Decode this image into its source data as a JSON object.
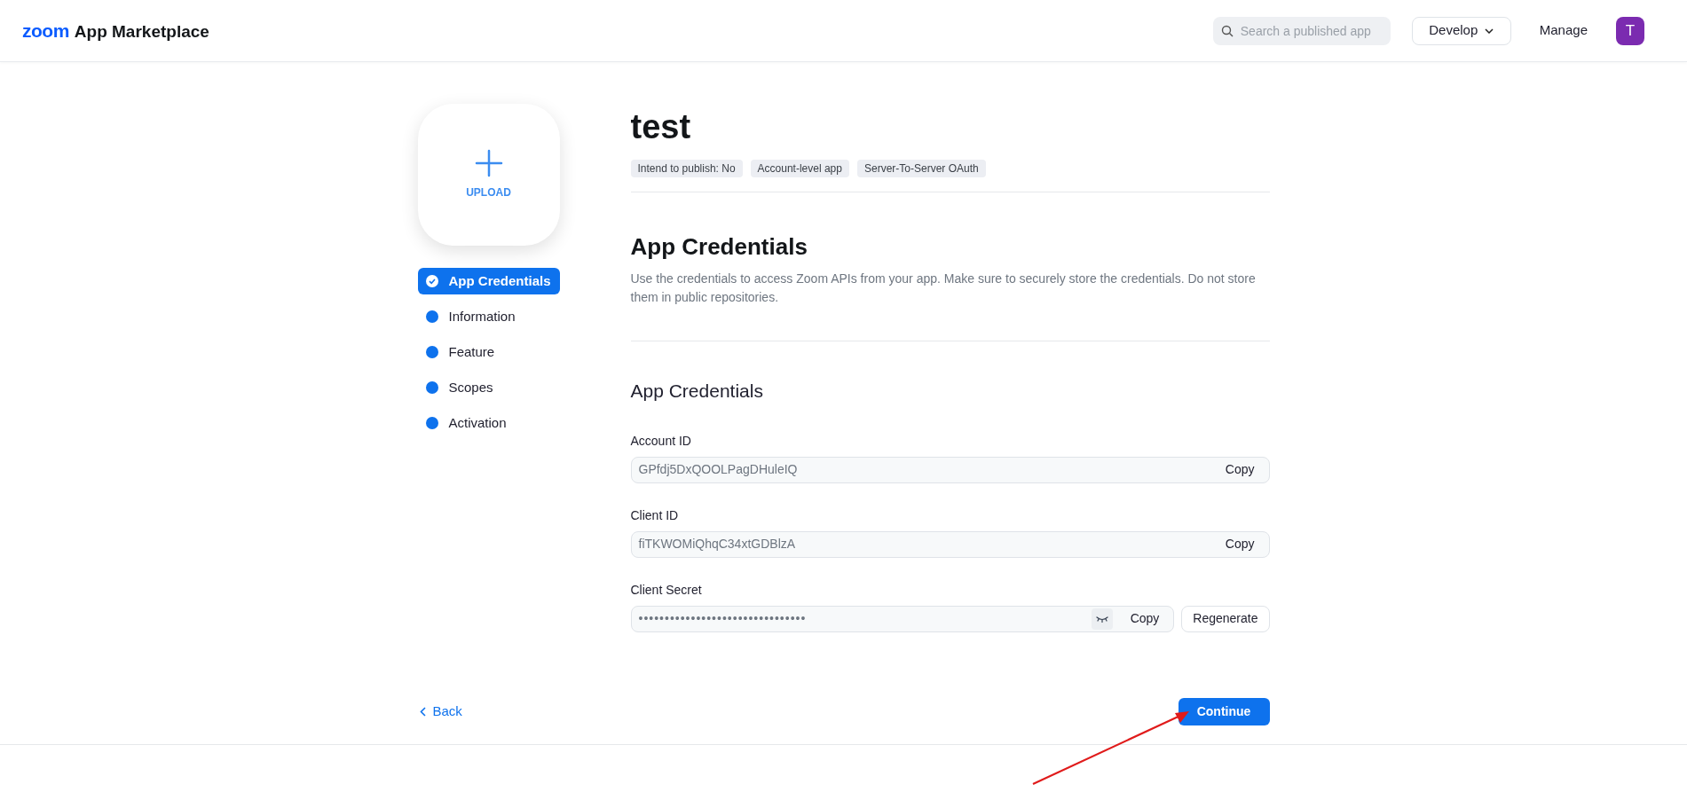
{
  "header": {
    "logo": "zoom",
    "product": "App Marketplace",
    "search": {
      "placeholder": "Search a published app"
    },
    "develop_menu": "Develop",
    "manage_link": "Manage",
    "avatar": "T"
  },
  "upload": {
    "label": "UPLOAD"
  },
  "steps": [
    {
      "label": "App Credentials",
      "selected": true
    },
    {
      "label": "Information",
      "selected": false
    },
    {
      "label": "Feature",
      "selected": false
    },
    {
      "label": "Scopes",
      "selected": false
    },
    {
      "label": "Activation",
      "selected": false
    }
  ],
  "app": {
    "name": "test",
    "tags": [
      "Intend to publish: No",
      "Account-level app",
      "Server-To-Server OAuth"
    ]
  },
  "section": {
    "title": "App Credentials",
    "description": "Use the credentials to access Zoom APIs from your app. Make sure to securely store the credentials. Do not store them in public repositories.",
    "subtitle": "App Credentials"
  },
  "fields": [
    {
      "label": "Account ID",
      "kind": "text",
      "value": "GPfdj5DxQOOLPagDHuleIQ",
      "copy": "Copy"
    },
    {
      "label": "Client ID",
      "kind": "text",
      "value": "fiTKWOMiQhqC34xtGDBlzA",
      "copy": "Copy"
    },
    {
      "label": "Client Secret",
      "kind": "secret",
      "value": "••••••••••••••••••••••••••••••••",
      "copy": "Copy",
      "regenerate": "Regenerate"
    }
  ],
  "footer": {
    "back": "Back",
    "continue": "Continue"
  }
}
